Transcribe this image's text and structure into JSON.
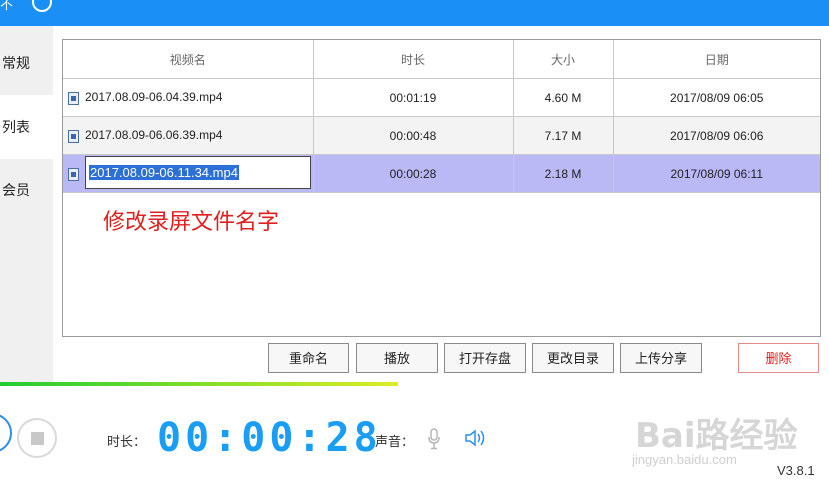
{
  "topbar": {
    "title_fragment": "不"
  },
  "sidebar": {
    "items": [
      {
        "label": "常规"
      },
      {
        "label": "列表"
      },
      {
        "label": "会员"
      }
    ]
  },
  "table": {
    "headers": [
      "视频名",
      "时长",
      "大小",
      "日期"
    ],
    "rows": [
      {
        "name": "2017.08.09-06.04.39.mp4",
        "duration": "00:01:19",
        "size": "4.60 M",
        "date": "2017/08/09 06:05"
      },
      {
        "name": "2017.08.09-06.06.39.mp4",
        "duration": "00:00:48",
        "size": "7.17 M",
        "date": "2017/08/09 06:06"
      },
      {
        "name": "2017.08.09-06.11.34.mp4",
        "duration": "00:00:28",
        "size": "2.18 M",
        "date": "2017/08/09 06:11"
      }
    ],
    "selected_row": 2,
    "editing_row": 2
  },
  "annotation": "修改录屏文件名字",
  "buttons": {
    "rename": "重命名",
    "play": "播放",
    "open_folder": "打开存盘",
    "change_dir": "更改目录",
    "upload_share": "上传分享",
    "delete": "删除"
  },
  "colors": {
    "accent": "#1a8ff5",
    "selected_row": "#bbb8f6",
    "delete": "#e02020",
    "timer": "#1a9ef5"
  },
  "recorder": {
    "time_label": "时长：",
    "timer": "00:00:28",
    "voice_label": "声音：",
    "progress": 0.48
  },
  "watermark": {
    "brand": "Bai路经验",
    "url": "jingyan.baidu.com"
  },
  "version": "V3.8.1"
}
